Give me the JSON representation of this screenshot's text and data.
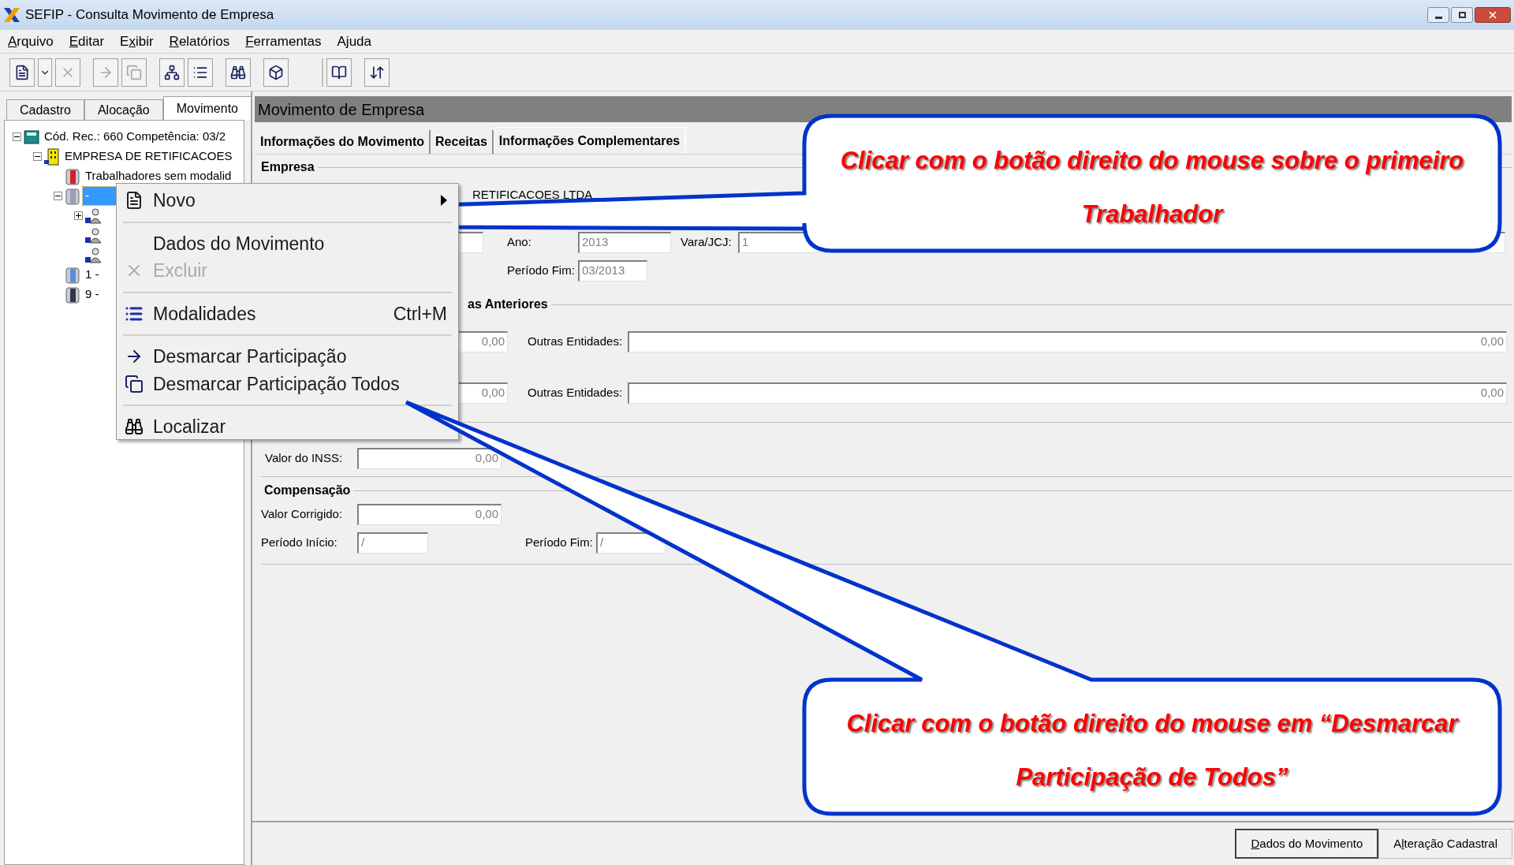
{
  "window": {
    "title": "SEFIP - Consulta Movimento de Empresa"
  },
  "menu_bar": [
    {
      "key": "A",
      "post": "rquivo"
    },
    {
      "key": "E",
      "post": "ditar"
    },
    {
      "pre": "E",
      "key": "x",
      "post": "ibir"
    },
    {
      "key": "R",
      "post": "elatórios"
    },
    {
      "key": "F",
      "post": "erramentas"
    },
    {
      "pre": "Ajuda"
    }
  ],
  "toolbar": [
    {
      "kind": "new",
      "disabled": false
    },
    {
      "kind": "dropdown",
      "disabled": false
    },
    {
      "kind": "delete",
      "disabled": true
    },
    {
      "kind": "sep"
    },
    {
      "kind": "unmark",
      "disabled": true
    },
    {
      "kind": "unmark_all",
      "disabled": true
    },
    {
      "kind": "sep"
    },
    {
      "kind": "tree",
      "disabled": false
    },
    {
      "kind": "list",
      "disabled": false
    },
    {
      "kind": "sep"
    },
    {
      "kind": "find",
      "disabled": false
    },
    {
      "kind": "sep"
    },
    {
      "kind": "cube",
      "disabled": false
    },
    {
      "kind": "bigsep"
    },
    {
      "kind": "book",
      "disabled": false
    },
    {
      "kind": "sep"
    },
    {
      "kind": "tool",
      "disabled": false
    }
  ],
  "left_tabs": [
    {
      "label": "Cadastro",
      "selected": false
    },
    {
      "label": "Alocação",
      "selected": false
    },
    {
      "label": "Movimento",
      "selected": true
    }
  ],
  "tree": [
    {
      "label": "Cód. Rec.: 660 Competência: 03/2",
      "kind": "calculator",
      "expanded": true,
      "selected": false,
      "children": [
        {
          "label": "EMPRESA DE RETIFICACOES",
          "kind": "building",
          "expanded": true,
          "selected": false,
          "children": [
            {
              "label": "Trabalhadores sem modalid",
              "kind": "bin",
              "color": "#d42020",
              "selected": false
            },
            {
              "label": "-",
              "kind": "bin",
              "color": "#9aa0b0",
              "expanded": true,
              "selected": true,
              "children": [
                {
                  "kind": "worker",
                  "expanded": false,
                  "selected": false
                },
                {
                  "kind": "worker",
                  "selected": false
                },
                {
                  "kind": "worker",
                  "selected": false
                }
              ]
            },
            {
              "label": "1 -",
              "kind": "bin",
              "color": "#5b8fd6",
              "selected": false
            },
            {
              "label": "9 -",
              "kind": "bin",
              "color": "#303848",
              "selected": false
            }
          ]
        }
      ]
    }
  ],
  "context_menu": [
    {
      "kind": "document",
      "label": "Novo",
      "submenu": true,
      "disabled": false
    },
    {
      "kind": "separator"
    },
    {
      "kind": "plain",
      "label": "Dados do Movimento",
      "submenu": false,
      "disabled": false
    },
    {
      "kind": "delete",
      "label": "Excluir",
      "submenu": false,
      "disabled": true
    },
    {
      "kind": "separator"
    },
    {
      "kind": "list",
      "label": "Modalidades",
      "shortcut": "Ctrl+M",
      "submenu": false,
      "disabled": false
    },
    {
      "kind": "separator"
    },
    {
      "kind": "unmark",
      "label": "Desmarcar Participação",
      "submenu": false,
      "disabled": false
    },
    {
      "kind": "unmark_all",
      "label": "Desmarcar Participação Todos",
      "submenu": false,
      "disabled": false
    },
    {
      "kind": "separator"
    },
    {
      "kind": "find",
      "label": "Localizar",
      "submenu": false,
      "disabled": false
    }
  ],
  "panel": {
    "title": "Movimento de Empresa",
    "tabs": [
      {
        "label": "Informações do Movimento",
        "selected": false
      },
      {
        "label": "Receitas",
        "selected": false
      },
      {
        "label": "Informações Complementares",
        "selected": true
      }
    ],
    "empresa": {
      "title": "Empresa",
      "name": "RETIFICACOES LTDA"
    },
    "processo": {
      "ano_label": "Ano:",
      "ano": "2013",
      "vara_label": "Vara/JCJ:",
      "vara": "1",
      "fim_label": "Período Fim:",
      "fim": "03/2013"
    },
    "anteriores": {
      "title": "as Anteriores",
      "rows": [
        {
          "value": "0,00",
          "other_label": "Outras Entidades:",
          "other_value": "0,00"
        },
        {
          "value": "0,00",
          "other_label": "Outras Entidades:",
          "other_value": "0,00"
        }
      ]
    },
    "inss": {
      "label": "Valor do INSS:",
      "value": "0,00"
    },
    "compensacao": {
      "title": "Compensação",
      "valor_label": "Valor Corrigido:",
      "valor": "0,00",
      "inicio_label": "Período Início:",
      "inicio": "/",
      "fim_label": "Período Fim:",
      "fim": "/"
    },
    "buttons": [
      {
        "key": "D",
        "post": "ados do Movimento"
      },
      {
        "pre": "A",
        "key": "l",
        "post": "teração Cadastral"
      }
    ]
  },
  "callouts": [
    {
      "text": "Clicar com o botão direito do mouse sobre o primeiro Trabalhador"
    },
    {
      "text": "Clicar com o botão direito do mouse  em “Desmarcar Participação de Todos”"
    }
  ]
}
